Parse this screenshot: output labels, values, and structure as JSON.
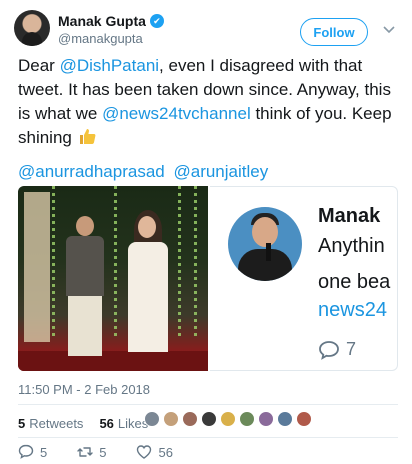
{
  "author": {
    "name": "Manak Gupta",
    "handle": "@manakgupta",
    "verified_mark": "✔"
  },
  "follow_label": "Follow",
  "tweet": {
    "segments": [
      {
        "text": "Dear ",
        "mention": false
      },
      {
        "text": "@DishPatani",
        "mention": true
      },
      {
        "text": ", even I disagreed with that tweet. It has been taken down since. Anyway, this is what we ",
        "mention": false
      },
      {
        "text": "@news24tvchannel",
        "mention": true
      },
      {
        "text": " think of you. Keep shining ",
        "mention": false
      }
    ],
    "emoji": "thumbs-up-emoji",
    "mentions": [
      "@anurradhaprasad",
      "@arunjaitley"
    ]
  },
  "quoted_card": {
    "name": "Manak",
    "line1": "Anythin",
    "line2": "one bea",
    "line3": "news24",
    "reply_count": "7"
  },
  "timestamp": "11:50 PM - 2 Feb 2018",
  "stats": {
    "retweets_count": "5",
    "retweets_label": "Retweets",
    "likes_count": "56",
    "likes_label": "Likes"
  },
  "likers": [
    "#7b8794",
    "#c4a07a",
    "#9a6a5a",
    "#3a3a3a",
    "#d9b04a",
    "#6b8a5a",
    "#8a6a9a",
    "#5a7a9a",
    "#b05a4a"
  ],
  "actions": {
    "replies": "5",
    "retweets": "5",
    "likes": "56"
  },
  "colors": {
    "accent": "#1da1f2",
    "mention": "#1b95e0",
    "muted": "#657786"
  }
}
